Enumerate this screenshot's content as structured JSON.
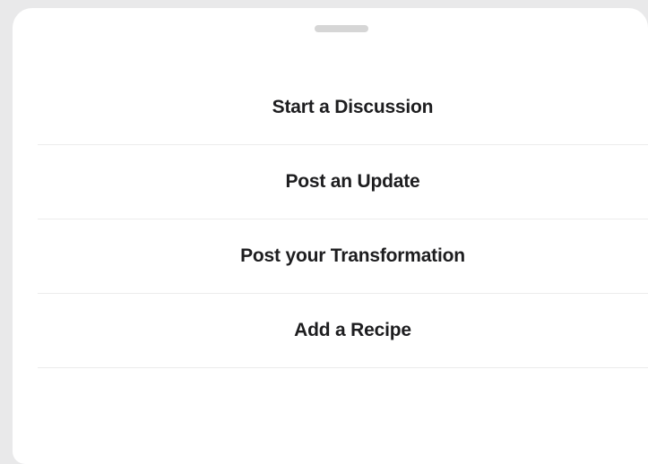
{
  "menu": {
    "items": [
      {
        "label": "Start a Discussion"
      },
      {
        "label": "Post an Update"
      },
      {
        "label": "Post your Transformation"
      },
      {
        "label": "Add a Recipe"
      }
    ]
  },
  "colors": {
    "backdrop": "#e9e9ea",
    "sheet": "#ffffff",
    "text": "#1d1d1f",
    "divider": "#ececec",
    "grabber": "#d6d6d6"
  }
}
